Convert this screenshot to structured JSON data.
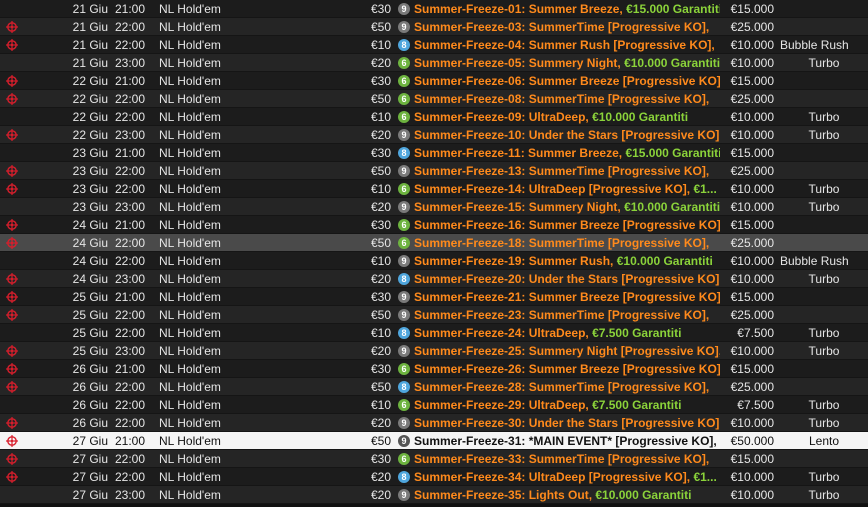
{
  "colors": {
    "row_odd": "#1c1c1c",
    "row_even": "#252525",
    "row_hover": "#4a4a4a",
    "row_selected": "#f5f5f5",
    "name_text": "#ff8a1c",
    "guarantee_text": "#8bd33a",
    "target_icon": "#d81e2c",
    "badge_9": "#7a7a7a",
    "badge_6": "#6db33f",
    "badge_8": "#4fa6dd"
  },
  "rows": [
    {
      "target": false,
      "day": "21 Giu",
      "time": "21:00",
      "game": "NL Hold'em",
      "buyin": "€30",
      "players": "9",
      "name": "Summer-Freeze-01: Summer Breeze, ",
      "guarantee": "€15.000 Garantiti",
      "prize": "€15.000",
      "type": "",
      "state": "normal"
    },
    {
      "target": true,
      "day": "21 Giu",
      "time": "22:00",
      "game": "NL Hold'em",
      "buyin": "€50",
      "players": "9",
      "name": "Summer-Freeze-03: SummerTime [Progressive KO],",
      "guarantee": "",
      "prize": "€25.000",
      "type": "",
      "state": "normal"
    },
    {
      "target": true,
      "day": "21 Giu",
      "time": "22:00",
      "game": "NL Hold'em",
      "buyin": "€10",
      "players": "8",
      "name": "Summer-Freeze-04: Summer Rush [Progressive KO],",
      "guarantee": "",
      "prize": "€10.000",
      "type": "Bubble Rush",
      "state": "normal"
    },
    {
      "target": false,
      "day": "21 Giu",
      "time": "23:00",
      "game": "NL Hold'em",
      "buyin": "€20",
      "players": "6",
      "name": "Summer-Freeze-05: Summery Night, ",
      "guarantee": "€10.000 Garantiti",
      "prize": "€10.000",
      "type": "Turbo",
      "state": "normal"
    },
    {
      "target": true,
      "day": "22 Giu",
      "time": "21:00",
      "game": "NL Hold'em",
      "buyin": "€30",
      "players": "6",
      "name": "Summer-Freeze-06: Summer Breeze [Progressive KO],",
      "guarantee": "",
      "prize": "€15.000",
      "type": "",
      "state": "normal"
    },
    {
      "target": true,
      "day": "22 Giu",
      "time": "22:00",
      "game": "NL Hold'em",
      "buyin": "€50",
      "players": "6",
      "name": "Summer-Freeze-08: SummerTime [Progressive KO],",
      "guarantee": "",
      "prize": "€25.000",
      "type": "",
      "state": "normal"
    },
    {
      "target": false,
      "day": "22 Giu",
      "time": "22:00",
      "game": "NL Hold'em",
      "buyin": "€10",
      "players": "6",
      "name": "Summer-Freeze-09: UltraDeep, ",
      "guarantee": "€10.000 Garantiti",
      "prize": "€10.000",
      "type": "Turbo",
      "state": "normal"
    },
    {
      "target": true,
      "day": "22 Giu",
      "time": "23:00",
      "game": "NL Hold'em",
      "buyin": "€20",
      "players": "9",
      "name": "Summer-Freeze-10: Under the Stars [Progressive KO],",
      "guarantee": "",
      "prize": "€10.000",
      "type": "Turbo",
      "state": "normal"
    },
    {
      "target": false,
      "day": "23 Giu",
      "time": "21:00",
      "game": "NL Hold'em",
      "buyin": "€30",
      "players": "8",
      "name": "Summer-Freeze-11: Summer Breeze, ",
      "guarantee": "€15.000 Garantiti",
      "prize": "€15.000",
      "type": "",
      "state": "normal"
    },
    {
      "target": true,
      "day": "23 Giu",
      "time": "22:00",
      "game": "NL Hold'em",
      "buyin": "€50",
      "players": "9",
      "name": "Summer-Freeze-13: SummerTime [Progressive KO],",
      "guarantee": "",
      "prize": "€25.000",
      "type": "",
      "state": "normal"
    },
    {
      "target": true,
      "day": "23 Giu",
      "time": "22:00",
      "game": "NL Hold'em",
      "buyin": "€10",
      "players": "6",
      "name": "Summer-Freeze-14: UltraDeep [Progressive KO], ",
      "guarantee": "€1...",
      "prize": "€10.000",
      "type": "Turbo",
      "state": "normal"
    },
    {
      "target": false,
      "day": "23 Giu",
      "time": "23:00",
      "game": "NL Hold'em",
      "buyin": "€20",
      "players": "9",
      "name": "Summer-Freeze-15: Summery Night, ",
      "guarantee": "€10.000 Garantiti",
      "prize": "€10.000",
      "type": "Turbo",
      "state": "normal"
    },
    {
      "target": true,
      "day": "24 Giu",
      "time": "21:00",
      "game": "NL Hold'em",
      "buyin": "€30",
      "players": "6",
      "name": "Summer-Freeze-16: Summer Breeze [Progressive KO],",
      "guarantee": "",
      "prize": "€15.000",
      "type": "",
      "state": "normal"
    },
    {
      "target": true,
      "day": "24 Giu",
      "time": "22:00",
      "game": "NL Hold'em",
      "buyin": "€50",
      "players": "6",
      "name": "Summer-Freeze-18: SummerTime [Progressive KO],",
      "guarantee": "",
      "prize": "€25.000",
      "type": "",
      "state": "hover"
    },
    {
      "target": false,
      "day": "24 Giu",
      "time": "22:00",
      "game": "NL Hold'em",
      "buyin": "€10",
      "players": "9",
      "name": "Summer-Freeze-19: Summer Rush, ",
      "guarantee": "€10.000 Garantiti",
      "prize": "€10.000",
      "type": "Bubble Rush",
      "state": "normal"
    },
    {
      "target": true,
      "day": "24 Giu",
      "time": "23:00",
      "game": "NL Hold'em",
      "buyin": "€20",
      "players": "8",
      "name": "Summer-Freeze-20: Under the Stars [Progressive KO],",
      "guarantee": "",
      "prize": "€10.000",
      "type": "Turbo",
      "state": "normal"
    },
    {
      "target": true,
      "day": "25 Giu",
      "time": "21:00",
      "game": "NL Hold'em",
      "buyin": "€30",
      "players": "9",
      "name": "Summer-Freeze-21: Summer Breeze [Progressive KO],",
      "guarantee": "",
      "prize": "€15.000",
      "type": "",
      "state": "normal"
    },
    {
      "target": true,
      "day": "25 Giu",
      "time": "22:00",
      "game": "NL Hold'em",
      "buyin": "€50",
      "players": "9",
      "name": "Summer-Freeze-23: SummerTime [Progressive KO],",
      "guarantee": "",
      "prize": "€25.000",
      "type": "",
      "state": "normal"
    },
    {
      "target": false,
      "day": "25 Giu",
      "time": "22:00",
      "game": "NL Hold'em",
      "buyin": "€10",
      "players": "8",
      "name": "Summer-Freeze-24: UltraDeep, ",
      "guarantee": "€7.500 Garantiti",
      "prize": "€7.500",
      "type": "Turbo",
      "state": "normal"
    },
    {
      "target": true,
      "day": "25 Giu",
      "time": "23:00",
      "game": "NL Hold'em",
      "buyin": "€20",
      "players": "9",
      "name": "Summer-Freeze-25: Summery Night [Progressive KO],",
      "guarantee": "",
      "prize": "€10.000",
      "type": "Turbo",
      "state": "normal"
    },
    {
      "target": true,
      "day": "26 Giu",
      "time": "21:00",
      "game": "NL Hold'em",
      "buyin": "€30",
      "players": "6",
      "name": "Summer-Freeze-26: Summer Breeze [Progressive KO],",
      "guarantee": "",
      "prize": "€15.000",
      "type": "",
      "state": "normal"
    },
    {
      "target": true,
      "day": "26 Giu",
      "time": "22:00",
      "game": "NL Hold'em",
      "buyin": "€50",
      "players": "8",
      "name": "Summer-Freeze-28: SummerTime [Progressive KO],",
      "guarantee": "",
      "prize": "€25.000",
      "type": "",
      "state": "normal"
    },
    {
      "target": false,
      "day": "26 Giu",
      "time": "22:00",
      "game": "NL Hold'em",
      "buyin": "€10",
      "players": "6",
      "name": "Summer-Freeze-29: UltraDeep, ",
      "guarantee": "€7.500 Garantiti",
      "prize": "€7.500",
      "type": "Turbo",
      "state": "normal"
    },
    {
      "target": true,
      "day": "26 Giu",
      "time": "22:00",
      "game": "NL Hold'em",
      "buyin": "€20",
      "players": "9",
      "name": "Summer-Freeze-30: Under the Stars [Progressive KO],",
      "guarantee": "",
      "prize": "€10.000",
      "type": "Turbo",
      "state": "normal"
    },
    {
      "target": true,
      "day": "27 Giu",
      "time": "21:00",
      "game": "NL Hold'em",
      "buyin": "€50",
      "players": "9",
      "name": "Summer-Freeze-31: *MAIN EVENT* [Progressive KO],",
      "guarantee": "",
      "prize": "€50.000",
      "type": "Lento",
      "state": "selected"
    },
    {
      "target": true,
      "day": "27 Giu",
      "time": "22:00",
      "game": "NL Hold'em",
      "buyin": "€30",
      "players": "6",
      "name": "Summer-Freeze-33: SummerTime [Progressive KO],",
      "guarantee": "",
      "prize": "€15.000",
      "type": "",
      "state": "normal"
    },
    {
      "target": true,
      "day": "27 Giu",
      "time": "22:00",
      "game": "NL Hold'em",
      "buyin": "€20",
      "players": "8",
      "name": "Summer-Freeze-34: UltraDeep [Progressive KO], ",
      "guarantee": "€1...",
      "prize": "€10.000",
      "type": "Turbo",
      "state": "normal"
    },
    {
      "target": false,
      "day": "27 Giu",
      "time": "23:00",
      "game": "NL Hold'em",
      "buyin": "€20",
      "players": "9",
      "name": "Summer-Freeze-35: Lights Out, ",
      "guarantee": "€10.000 Garantiti",
      "prize": "€10.000",
      "type": "Turbo",
      "state": "normal"
    }
  ]
}
